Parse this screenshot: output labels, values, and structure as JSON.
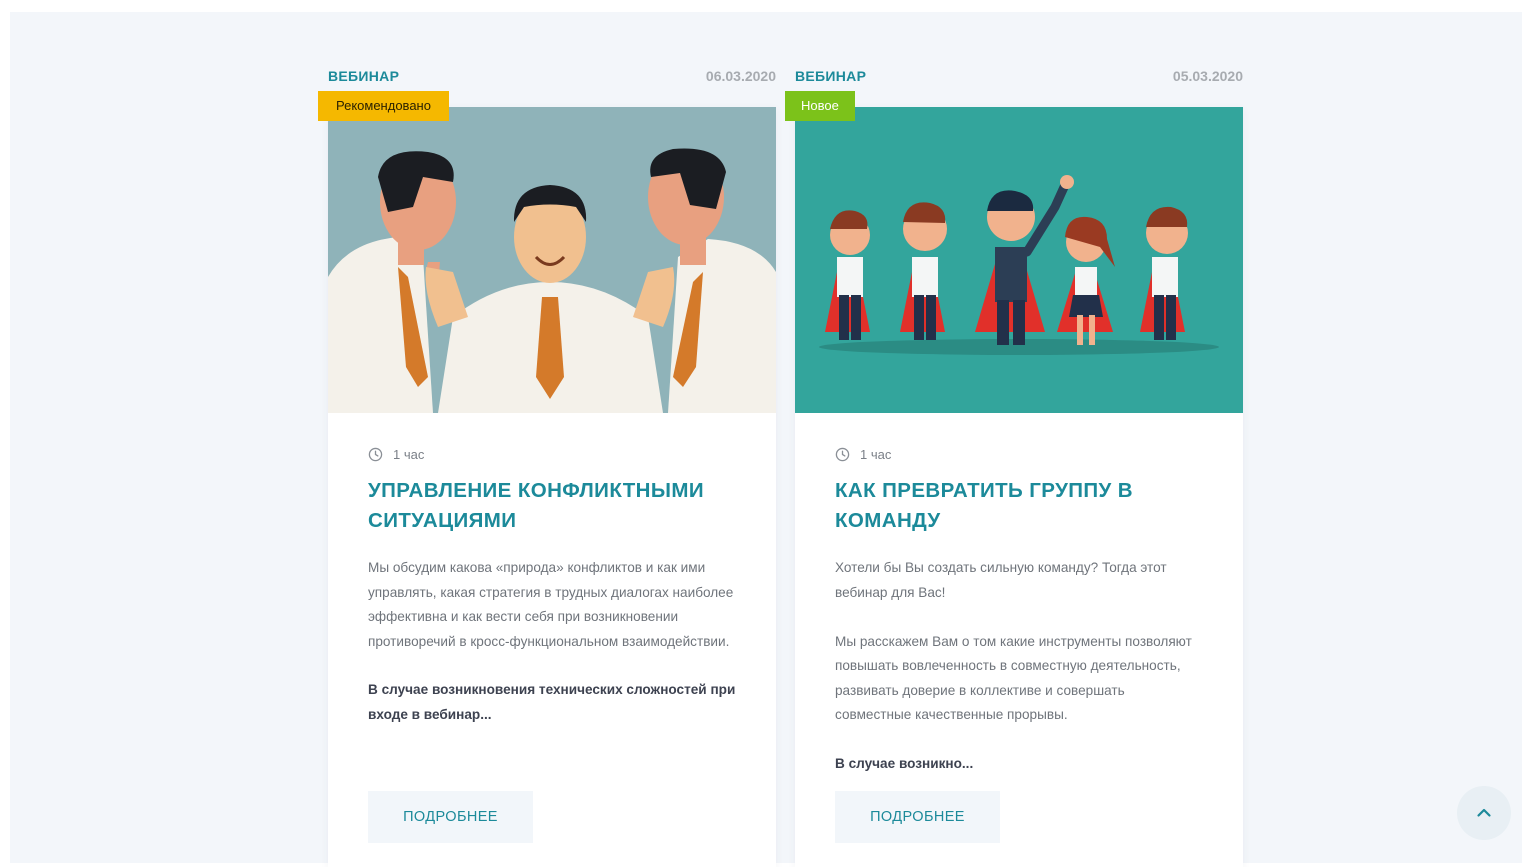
{
  "cards": [
    {
      "type": "ВЕБИНАР",
      "date": "06.03.2020",
      "badge": "Рекомендовано",
      "duration": "1 час",
      "title": "Управление конфликтными ситуациями",
      "description": [
        "Мы обсудим какова «природа» конфликтов и как ими управлять, какая стратегия в трудных диалогах наиболее эффективна и как вести себя при возникновении противоречий в кросс-функциональном взаимодействии."
      ],
      "note": "В случае возникновения технических сложностей при входе в вебинар...",
      "button": "ПОДРОБНЕЕ",
      "image_bg": "#8fb3b9"
    },
    {
      "type": "ВЕБИНАР",
      "date": "05.03.2020",
      "badge": "Новое",
      "duration": "1 час",
      "title": "Как превратить группу в команду",
      "description": [
        "Хотели бы Вы создать сильную команду? Тогда этот вебинар для Вас!",
        "Мы расскажем Вам о том какие инструменты позволяют повышать вовлеченность в совместную деятельность, развивать доверие в коллективе и совершать совместные качественные прорывы."
      ],
      "note": "В случае возникно...",
      "button": "ПОДРОБНЕЕ",
      "image_bg": "#33a59c"
    }
  ],
  "colors": {
    "accent": "#1c8a9a",
    "badge_recommended": "#f5b800",
    "badge_new": "#7cc21a",
    "page_bg": "#f3f6fa"
  },
  "icons": {
    "duration": "clock-icon",
    "scroll_top": "chevron-up-icon"
  }
}
